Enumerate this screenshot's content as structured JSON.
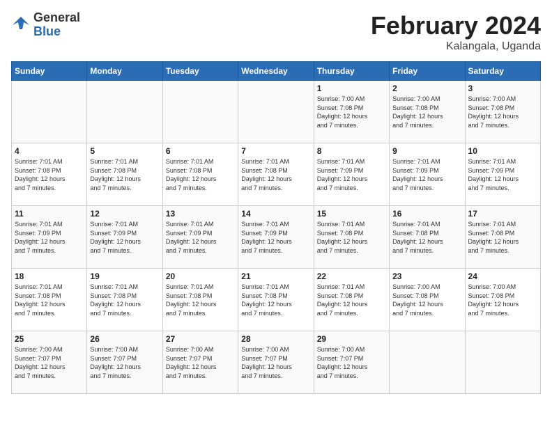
{
  "header": {
    "logo_general": "General",
    "logo_blue": "Blue",
    "month_year": "February 2024",
    "location": "Kalangala, Uganda"
  },
  "weekdays": [
    "Sunday",
    "Monday",
    "Tuesday",
    "Wednesday",
    "Thursday",
    "Friday",
    "Saturday"
  ],
  "weeks": [
    [
      {
        "day": "",
        "info": ""
      },
      {
        "day": "",
        "info": ""
      },
      {
        "day": "",
        "info": ""
      },
      {
        "day": "",
        "info": ""
      },
      {
        "day": "1",
        "info": "Sunrise: 7:00 AM\nSunset: 7:08 PM\nDaylight: 12 hours\nand 7 minutes."
      },
      {
        "day": "2",
        "info": "Sunrise: 7:00 AM\nSunset: 7:08 PM\nDaylight: 12 hours\nand 7 minutes."
      },
      {
        "day": "3",
        "info": "Sunrise: 7:00 AM\nSunset: 7:08 PM\nDaylight: 12 hours\nand 7 minutes."
      }
    ],
    [
      {
        "day": "4",
        "info": "Sunrise: 7:01 AM\nSunset: 7:08 PM\nDaylight: 12 hours\nand 7 minutes."
      },
      {
        "day": "5",
        "info": "Sunrise: 7:01 AM\nSunset: 7:08 PM\nDaylight: 12 hours\nand 7 minutes."
      },
      {
        "day": "6",
        "info": "Sunrise: 7:01 AM\nSunset: 7:08 PM\nDaylight: 12 hours\nand 7 minutes."
      },
      {
        "day": "7",
        "info": "Sunrise: 7:01 AM\nSunset: 7:08 PM\nDaylight: 12 hours\nand 7 minutes."
      },
      {
        "day": "8",
        "info": "Sunrise: 7:01 AM\nSunset: 7:09 PM\nDaylight: 12 hours\nand 7 minutes."
      },
      {
        "day": "9",
        "info": "Sunrise: 7:01 AM\nSunset: 7:09 PM\nDaylight: 12 hours\nand 7 minutes."
      },
      {
        "day": "10",
        "info": "Sunrise: 7:01 AM\nSunset: 7:09 PM\nDaylight: 12 hours\nand 7 minutes."
      }
    ],
    [
      {
        "day": "11",
        "info": "Sunrise: 7:01 AM\nSunset: 7:09 PM\nDaylight: 12 hours\nand 7 minutes."
      },
      {
        "day": "12",
        "info": "Sunrise: 7:01 AM\nSunset: 7:09 PM\nDaylight: 12 hours\nand 7 minutes."
      },
      {
        "day": "13",
        "info": "Sunrise: 7:01 AM\nSunset: 7:09 PM\nDaylight: 12 hours\nand 7 minutes."
      },
      {
        "day": "14",
        "info": "Sunrise: 7:01 AM\nSunset: 7:09 PM\nDaylight: 12 hours\nand 7 minutes."
      },
      {
        "day": "15",
        "info": "Sunrise: 7:01 AM\nSunset: 7:08 PM\nDaylight: 12 hours\nand 7 minutes."
      },
      {
        "day": "16",
        "info": "Sunrise: 7:01 AM\nSunset: 7:08 PM\nDaylight: 12 hours\nand 7 minutes."
      },
      {
        "day": "17",
        "info": "Sunrise: 7:01 AM\nSunset: 7:08 PM\nDaylight: 12 hours\nand 7 minutes."
      }
    ],
    [
      {
        "day": "18",
        "info": "Sunrise: 7:01 AM\nSunset: 7:08 PM\nDaylight: 12 hours\nand 7 minutes."
      },
      {
        "day": "19",
        "info": "Sunrise: 7:01 AM\nSunset: 7:08 PM\nDaylight: 12 hours\nand 7 minutes."
      },
      {
        "day": "20",
        "info": "Sunrise: 7:01 AM\nSunset: 7:08 PM\nDaylight: 12 hours\nand 7 minutes."
      },
      {
        "day": "21",
        "info": "Sunrise: 7:01 AM\nSunset: 7:08 PM\nDaylight: 12 hours\nand 7 minutes."
      },
      {
        "day": "22",
        "info": "Sunrise: 7:01 AM\nSunset: 7:08 PM\nDaylight: 12 hours\nand 7 minutes."
      },
      {
        "day": "23",
        "info": "Sunrise: 7:00 AM\nSunset: 7:08 PM\nDaylight: 12 hours\nand 7 minutes."
      },
      {
        "day": "24",
        "info": "Sunrise: 7:00 AM\nSunset: 7:08 PM\nDaylight: 12 hours\nand 7 minutes."
      }
    ],
    [
      {
        "day": "25",
        "info": "Sunrise: 7:00 AM\nSunset: 7:07 PM\nDaylight: 12 hours\nand 7 minutes."
      },
      {
        "day": "26",
        "info": "Sunrise: 7:00 AM\nSunset: 7:07 PM\nDaylight: 12 hours\nand 7 minutes."
      },
      {
        "day": "27",
        "info": "Sunrise: 7:00 AM\nSunset: 7:07 PM\nDaylight: 12 hours\nand 7 minutes."
      },
      {
        "day": "28",
        "info": "Sunrise: 7:00 AM\nSunset: 7:07 PM\nDaylight: 12 hours\nand 7 minutes."
      },
      {
        "day": "29",
        "info": "Sunrise: 7:00 AM\nSunset: 7:07 PM\nDaylight: 12 hours\nand 7 minutes."
      },
      {
        "day": "",
        "info": ""
      },
      {
        "day": "",
        "info": ""
      }
    ]
  ]
}
